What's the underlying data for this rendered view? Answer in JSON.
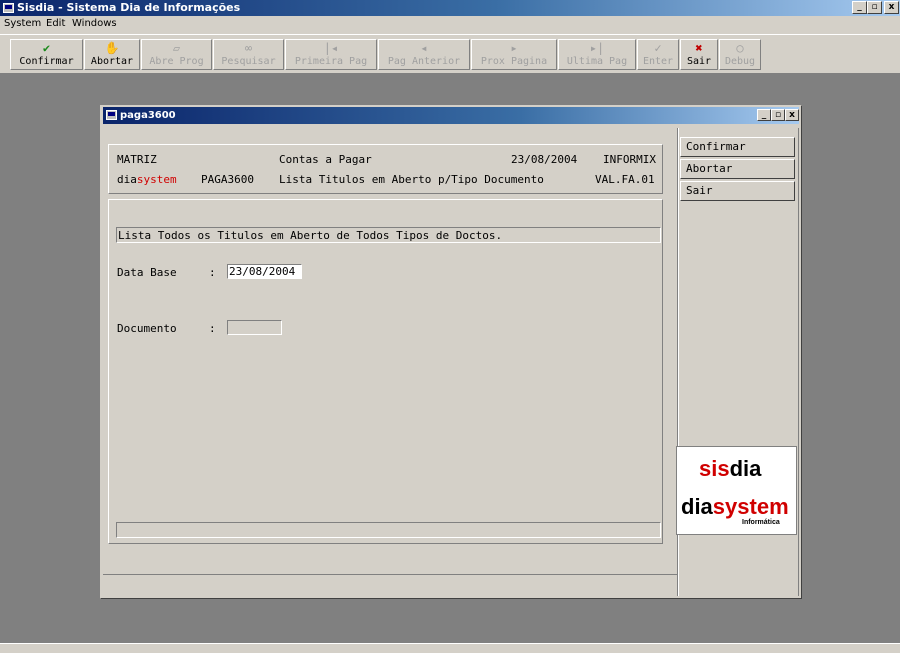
{
  "app": {
    "title": "Sisdia - Sistema Dia de Informações",
    "window_buttons": {
      "minimize": "_",
      "maximize": "▫",
      "close": "x"
    }
  },
  "menu": [
    "System",
    "Edit",
    "Windows"
  ],
  "toolbar": [
    {
      "label": "Confirmar",
      "icon": "check-icon",
      "glyph": "✔",
      "enabled": true,
      "color": "#1a8a1a"
    },
    {
      "label": "Abortar",
      "icon": "hand-icon",
      "glyph": "✋",
      "enabled": true,
      "color": "#000000"
    },
    {
      "label": "Abre Prog",
      "icon": "folder-icon",
      "glyph": "📂",
      "enabled": false,
      "color": "#a0a0a0"
    },
    {
      "label": "Pesquisar",
      "icon": "binoculars-icon",
      "glyph": "⚲",
      "enabled": false,
      "color": "#a0a0a0"
    },
    {
      "label": "Primeira Pag",
      "icon": "first-page-icon",
      "glyph": "|◀",
      "enabled": false,
      "color": "#a0a0a0"
    },
    {
      "label": "Pag Anterior",
      "icon": "prev-page-icon",
      "glyph": "◀",
      "enabled": false,
      "color": "#a0a0a0"
    },
    {
      "label": "Prox Pagina",
      "icon": "next-page-icon",
      "glyph": "▶",
      "enabled": false,
      "color": "#a0a0a0"
    },
    {
      "label": "Ultima Pag",
      "icon": "last-page-icon",
      "glyph": "▶|",
      "enabled": false,
      "color": "#a0a0a0"
    },
    {
      "label": "Enter",
      "icon": "enter-check-icon",
      "glyph": "✓",
      "enabled": false,
      "color": "#a0a0a0"
    },
    {
      "label": "Sair",
      "icon": "exit-x-icon",
      "glyph": "✖",
      "enabled": true,
      "color": "#c00000"
    },
    {
      "label": "Debug",
      "icon": "magnifier-icon",
      "glyph": "⚲",
      "enabled": false,
      "color": "#a0a0a0"
    }
  ],
  "child": {
    "title": "paga3600",
    "header": {
      "company": "MATRIZ",
      "module": "Contas a Pagar",
      "date": "23/08/2004",
      "db": "INFORMIX",
      "brand_prefix": "dia",
      "brand_suffix": "system",
      "program": "PAGA3600",
      "description": "Lista Titulos em Aberto p/Tipo Documento",
      "version": "VAL.FA.01"
    },
    "info": "Lista Todos os Titulos em Aberto de Todos Tipos de Doctos.",
    "fields": {
      "data_base_label": "Data Base",
      "data_base_sep": ":",
      "data_base_value": "23/08/2004",
      "documento_label": "Documento",
      "documento_sep": ":",
      "documento_value": ""
    },
    "status_message": "",
    "side_buttons": [
      "Confirmar",
      "Abortar",
      "Sair"
    ],
    "logo": {
      "top_left": "sis",
      "top_right": "dia",
      "bottom_left": "dia",
      "bottom_right": "system",
      "tagline": "Informática",
      "red": "#d00000",
      "black": "#000000"
    }
  }
}
